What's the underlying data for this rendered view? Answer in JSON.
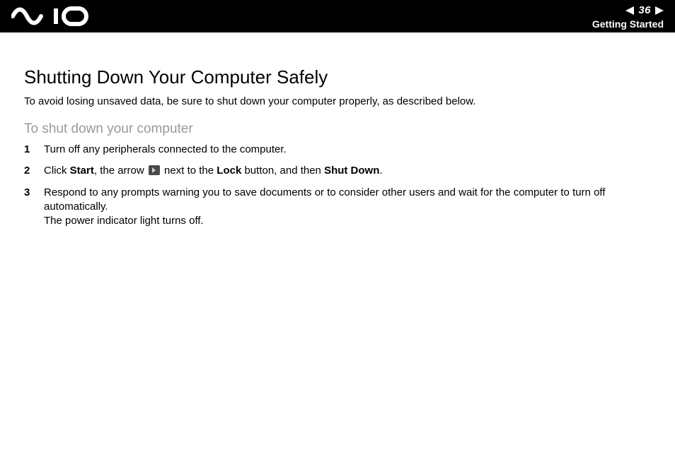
{
  "header": {
    "page_number": "36",
    "section": "Getting Started"
  },
  "main": {
    "title": "Shutting Down Your Computer Safely",
    "intro": "To avoid losing unsaved data, be sure to shut down your computer properly, as described below.",
    "subtitle": "To shut down your computer",
    "steps": {
      "s1_num": "1",
      "s1_text": "Turn off any peripherals connected to the computer.",
      "s2_num": "2",
      "s2_pre": "Click ",
      "s2_b1": "Start",
      "s2_mid1": ", the arrow ",
      "s2_mid2": " next to the ",
      "s2_b2": "Lock",
      "s2_mid3": " button, and then ",
      "s2_b3": "Shut Down",
      "s2_post": ".",
      "s3_num": "3",
      "s3_line1": "Respond to any prompts warning you to save documents or to consider other users and wait for the computer to turn off automatically.",
      "s3_line2": "The power indicator light turns off."
    }
  }
}
